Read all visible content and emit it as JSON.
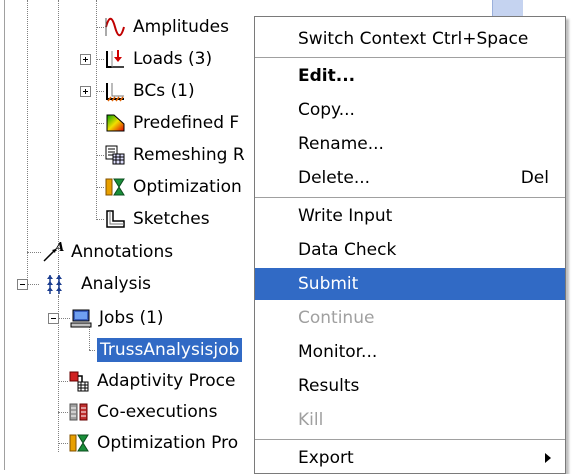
{
  "tree": {
    "items": [
      {
        "label": "Amplitudes",
        "icon": "amplitude-icon"
      },
      {
        "label": "Loads (3)",
        "icon": "load-icon"
      },
      {
        "label": "BCs (1)",
        "icon": "bc-icon"
      },
      {
        "label": "Predefined F",
        "icon": "predefined-field-icon"
      },
      {
        "label": "Remeshing R",
        "icon": "remeshing-rule-icon"
      },
      {
        "label": "Optimization",
        "icon": "optimization-icon"
      },
      {
        "label": "Sketches",
        "icon": "sketch-icon"
      },
      {
        "label": "Annotations",
        "icon": "annotation-icon"
      },
      {
        "label": "Analysis",
        "icon": "analysis-icon"
      },
      {
        "label": "Jobs (1)",
        "icon": "jobs-icon"
      },
      {
        "label": "TrussAnalysisjob",
        "icon": ""
      },
      {
        "label": "Adaptivity Proce",
        "icon": "adaptivity-icon"
      },
      {
        "label": "Co-executions",
        "icon": "co-execution-icon"
      },
      {
        "label": "Optimization Pro",
        "icon": "optimization-process-icon"
      }
    ]
  },
  "context_menu": {
    "items": [
      {
        "label": "Switch Context",
        "shortcut": "Ctrl+Space"
      },
      {
        "label": "Edit..."
      },
      {
        "label": "Copy..."
      },
      {
        "label": "Rename..."
      },
      {
        "label": "Delete...",
        "shortcut": "Del"
      },
      {
        "label": "Write Input"
      },
      {
        "label": "Data Check"
      },
      {
        "label": "Submit"
      },
      {
        "label": "Continue"
      },
      {
        "label": "Monitor..."
      },
      {
        "label": "Results"
      },
      {
        "label": "Kill"
      },
      {
        "label": "Export"
      }
    ]
  },
  "colors": {
    "selection": "#316ac5",
    "disabled_text": "#a0a0a0"
  }
}
